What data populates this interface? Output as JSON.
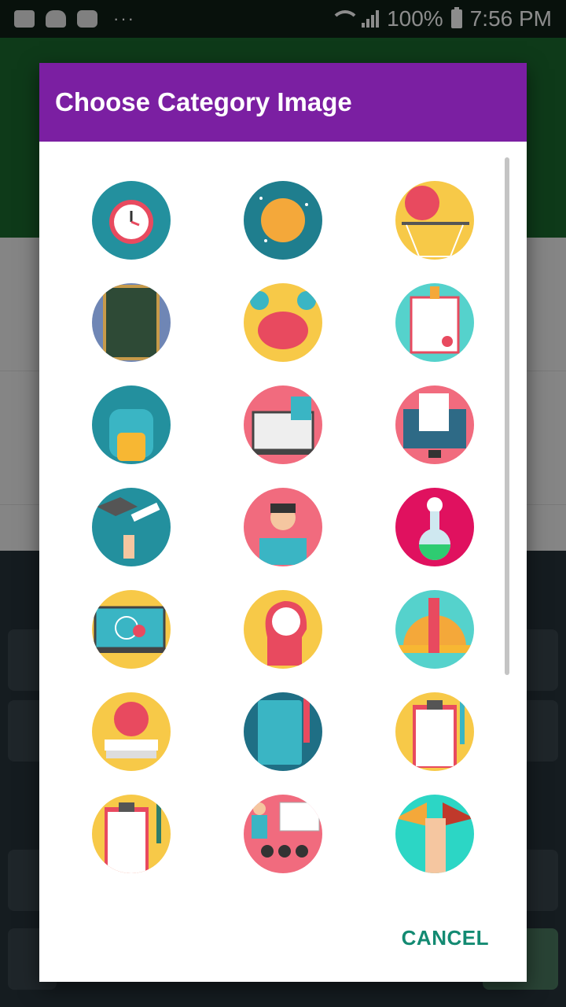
{
  "status_bar": {
    "battery": "100%",
    "time": "7:56 PM",
    "dots": "···"
  },
  "dialog": {
    "title": "Choose Category Image",
    "cancel_label": "CANCEL"
  },
  "images": [
    {
      "name": "alarm-clock-icon",
      "bg": "#23909e"
    },
    {
      "name": "planet-icon",
      "bg": "#1f7e8e"
    },
    {
      "name": "basketball-hoop-icon",
      "bg": "#f7c948"
    },
    {
      "name": "chalkboard-icon",
      "bg": "#6f86b5"
    },
    {
      "name": "brain-question-icon",
      "bg": "#f7c948"
    },
    {
      "name": "certificate-icon",
      "bg": "#55d2cc"
    },
    {
      "name": "backpack-icon",
      "bg": "#23909e"
    },
    {
      "name": "laptop-books-icon",
      "bg": "#f16b7e"
    },
    {
      "name": "computer-document-icon",
      "bg": "#f16b7e"
    },
    {
      "name": "graduation-cap-icon",
      "bg": "#23909e"
    },
    {
      "name": "reader-girl-icon",
      "bg": "#f16b7e"
    },
    {
      "name": "chemistry-flask-icon",
      "bg": "#e0115f"
    },
    {
      "name": "e-learning-laptop-icon",
      "bg": "#f7c948"
    },
    {
      "name": "mind-clock-icon",
      "bg": "#f7c948"
    },
    {
      "name": "ruler-pencil-icon",
      "bg": "#55d2cc"
    },
    {
      "name": "apple-books-icon",
      "bg": "#f7c948"
    },
    {
      "name": "notebook-pencil-icon",
      "bg": "#1f6f85"
    },
    {
      "name": "clipboard-checklist-icon",
      "bg": "#f7c948"
    },
    {
      "name": "clipboard-pen-icon",
      "bg": "#f7c948"
    },
    {
      "name": "teacher-presentation-icon",
      "bg": "#f16b7e"
    },
    {
      "name": "raised-hands-icon",
      "bg": "#2cd6c5"
    }
  ]
}
